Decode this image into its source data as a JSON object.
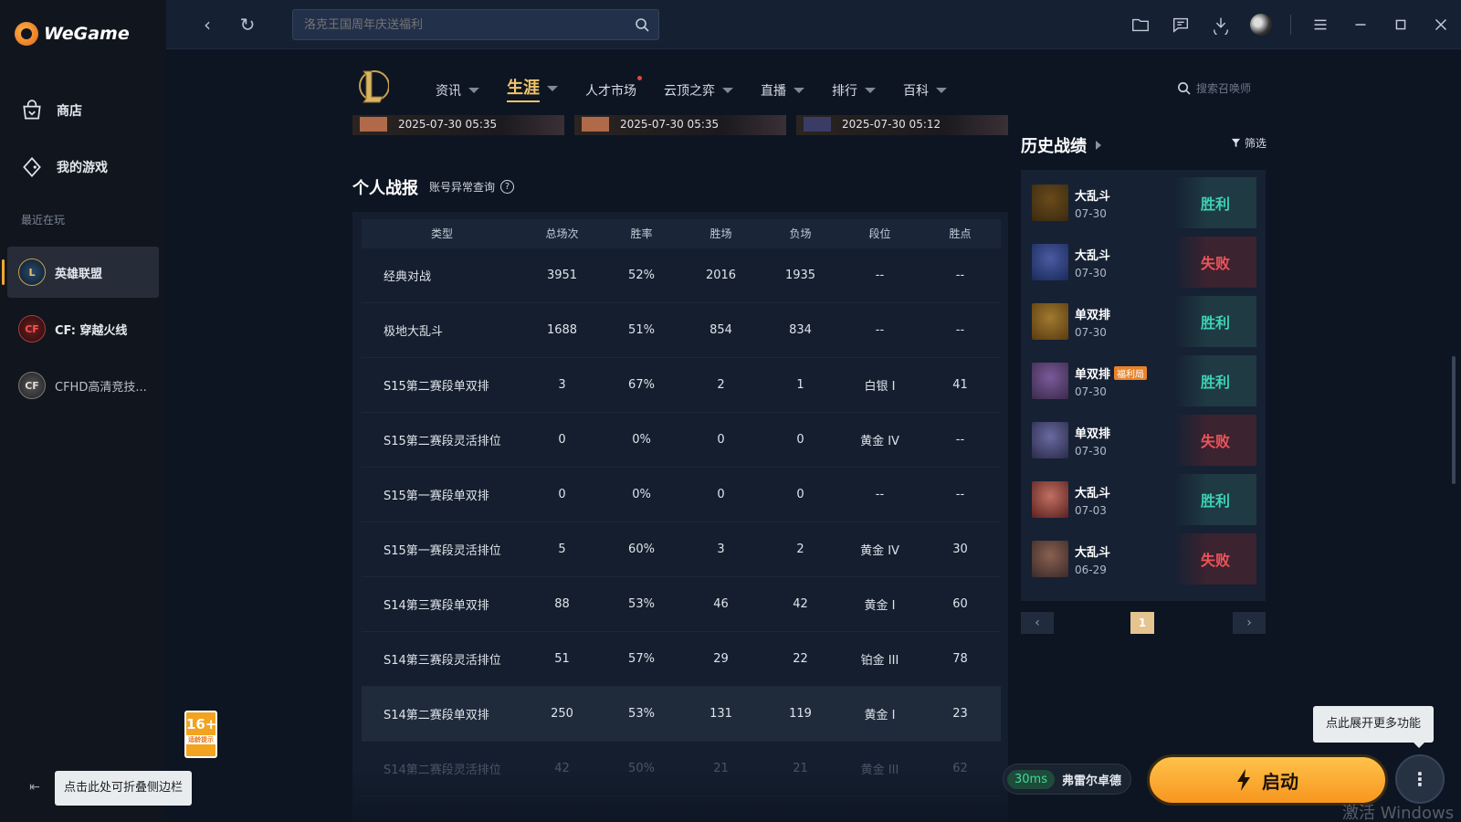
{
  "app": {
    "name": "WeGame"
  },
  "sidebar": {
    "items": [
      {
        "label": "商店",
        "icon": "store-icon"
      },
      {
        "label": "我的游戏",
        "icon": "gamepad-icon"
      }
    ],
    "recent_label": "最近在玩",
    "games": [
      {
        "label": "英雄联盟",
        "active": true
      },
      {
        "label": "CF: 穿越火线",
        "active": false
      },
      {
        "label": "CFHD高清竞技...",
        "active": false
      }
    ],
    "collapse_tip": "点击此处可折叠侧边栏",
    "age_badge": {
      "rating": "16+",
      "note": "适龄提示"
    }
  },
  "topbar": {
    "search_placeholder": "洛克王国周年庆送福利"
  },
  "lol_nav": {
    "tabs": [
      {
        "label": "资讯",
        "dropdown": true
      },
      {
        "label": "生涯",
        "dropdown": true,
        "active": true
      },
      {
        "label": "人才市场",
        "dropdown": false,
        "dot": true
      },
      {
        "label": "云顶之弈",
        "dropdown": true
      },
      {
        "label": "直播",
        "dropdown": true
      },
      {
        "label": "排行",
        "dropdown": true
      },
      {
        "label": "百科",
        "dropdown": true
      }
    ],
    "summoner_search_placeholder": "搜索召唤师"
  },
  "recent_matches_strip": [
    {
      "time": "2025-07-30 05:35"
    },
    {
      "time": "2025-07-30 05:35"
    },
    {
      "time": "2025-07-30 05:12"
    }
  ],
  "personal_stats": {
    "title": "个人战报",
    "account_check_link": "账号异常查询",
    "columns": [
      "类型",
      "总场次",
      "胜率",
      "胜场",
      "负场",
      "段位",
      "胜点"
    ],
    "rows": [
      [
        "经典对战",
        "3951",
        "52%",
        "2016",
        "1935",
        "--",
        "--"
      ],
      [
        "极地大乱斗",
        "1688",
        "51%",
        "854",
        "834",
        "--",
        "--"
      ],
      [
        "S15第二赛段单双排",
        "3",
        "67%",
        "2",
        "1",
        "白银 I",
        "41"
      ],
      [
        "S15第二赛段灵活排位",
        "0",
        "0%",
        "0",
        "0",
        "黄金 IV",
        "--"
      ],
      [
        "S15第一赛段单双排",
        "0",
        "0%",
        "0",
        "0",
        "--",
        "--"
      ],
      [
        "S15第一赛段灵活排位",
        "5",
        "60%",
        "3",
        "2",
        "黄金 IV",
        "30"
      ],
      [
        "S14第三赛段单双排",
        "88",
        "53%",
        "46",
        "42",
        "黄金 I",
        "60"
      ],
      [
        "S14第三赛段灵活排位",
        "51",
        "57%",
        "29",
        "22",
        "铂金 III",
        "78"
      ],
      [
        "S14第二赛段单双排",
        "250",
        "53%",
        "131",
        "119",
        "黄金 I",
        "23"
      ],
      [
        "S14第二赛段灵活排位",
        "42",
        "50%",
        "21",
        "21",
        "黄金 III",
        "62"
      ]
    ]
  },
  "history": {
    "title": "历史战绩",
    "filter_label": "筛选",
    "matches": [
      {
        "mode": "大乱斗",
        "date": "07-30",
        "result": "胜利",
        "win": true,
        "tag": ""
      },
      {
        "mode": "大乱斗",
        "date": "07-30",
        "result": "失败",
        "win": false,
        "tag": ""
      },
      {
        "mode": "单双排",
        "date": "07-30",
        "result": "胜利",
        "win": true,
        "tag": ""
      },
      {
        "mode": "单双排",
        "date": "07-30",
        "result": "胜利",
        "win": true,
        "tag": "福利局"
      },
      {
        "mode": "单双排",
        "date": "07-30",
        "result": "失败",
        "win": false,
        "tag": ""
      },
      {
        "mode": "大乱斗",
        "date": "07-03",
        "result": "胜利",
        "win": true,
        "tag": ""
      },
      {
        "mode": "大乱斗",
        "date": "06-29",
        "result": "失败",
        "win": false,
        "tag": ""
      }
    ],
    "current_page": "1"
  },
  "launch": {
    "ping": "30ms",
    "server": "弗雷尔卓德",
    "button_label": "启动",
    "more_tip": "点此展开更多功能"
  },
  "watermark": "激活 Windows",
  "colors": {
    "accent": "#f0c46a",
    "launch": "#f7a21f",
    "win": "#3dd1b4",
    "lose": "#f05358"
  }
}
